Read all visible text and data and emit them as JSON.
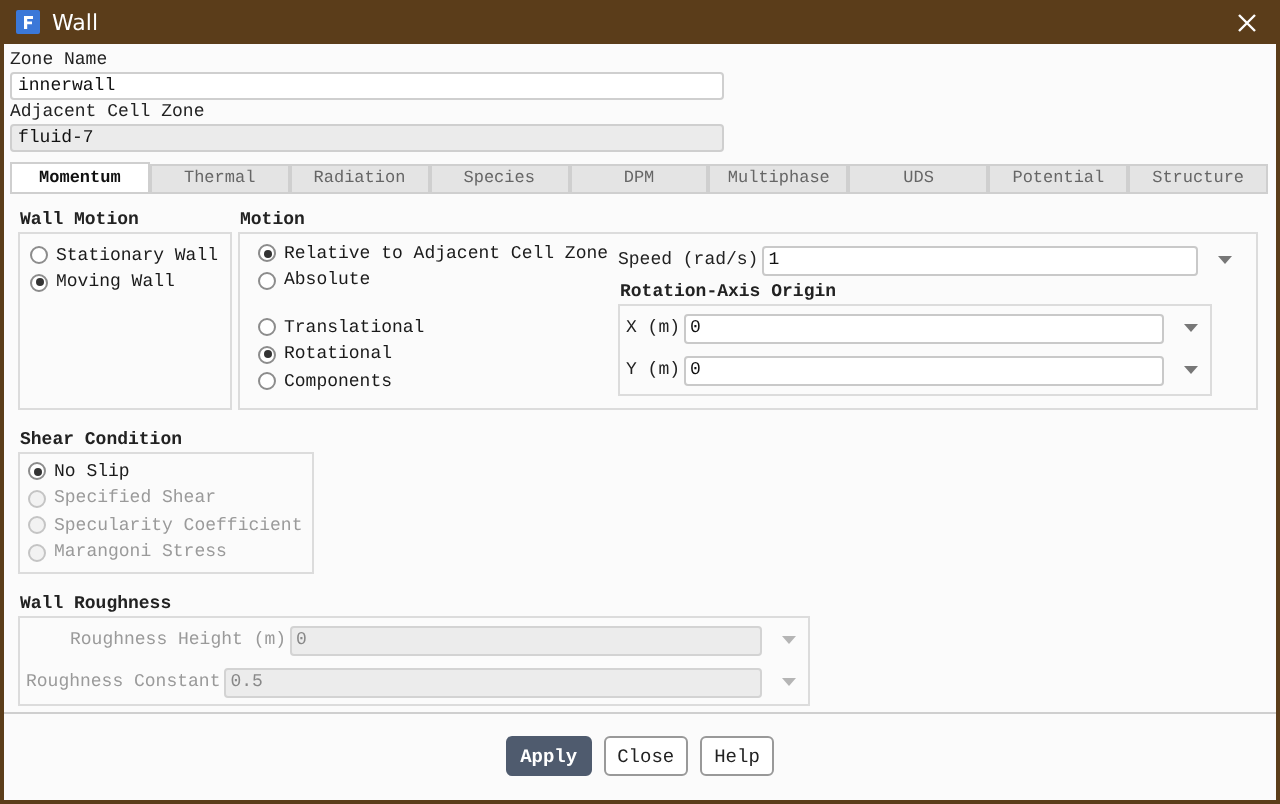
{
  "window": {
    "title": "Wall"
  },
  "zone_name": {
    "label": "Zone Name",
    "value": "innerwall",
    "disabled": false
  },
  "adjacent_cell_zone": {
    "label": "Adjacent Cell Zone",
    "value": "fluid-7",
    "disabled": true
  },
  "tabs": [
    {
      "label": "Momentum",
      "selected": true
    },
    {
      "label": "Thermal",
      "selected": false
    },
    {
      "label": "Radiation",
      "selected": false
    },
    {
      "label": "Species",
      "selected": false
    },
    {
      "label": "DPM",
      "selected": false
    },
    {
      "label": "Multiphase",
      "selected": false
    },
    {
      "label": "UDS",
      "selected": false
    },
    {
      "label": "Potential",
      "selected": false
    },
    {
      "label": "Structure",
      "selected": false
    }
  ],
  "wall_motion": {
    "title": "Wall Motion",
    "options": [
      {
        "label": "Stationary Wall",
        "selected": false,
        "disabled": false
      },
      {
        "label": "Moving Wall",
        "selected": true,
        "disabled": false
      }
    ]
  },
  "motion": {
    "title": "Motion",
    "reference": [
      {
        "label": "Relative to Adjacent Cell Zone",
        "selected": true,
        "disabled": false
      },
      {
        "label": "Absolute",
        "selected": false,
        "disabled": false
      }
    ],
    "type": [
      {
        "label": "Translational",
        "selected": false,
        "disabled": false
      },
      {
        "label": "Rotational",
        "selected": true,
        "disabled": false
      },
      {
        "label": "Components",
        "selected": false,
        "disabled": false
      }
    ],
    "speed": {
      "label": "Speed (rad/s)",
      "value": "1",
      "disabled": false,
      "dropdown": true
    },
    "rotation_axis_origin": {
      "title": "Rotation-Axis Origin",
      "fields": [
        {
          "label": "X (m)",
          "value": "0",
          "disabled": false,
          "dropdown": true
        },
        {
          "label": "Y (m)",
          "value": "0",
          "disabled": false,
          "dropdown": true
        }
      ]
    }
  },
  "shear_condition": {
    "title": "Shear Condition",
    "options": [
      {
        "label": "No Slip",
        "selected": true,
        "disabled": false
      },
      {
        "label": "Specified Shear",
        "selected": false,
        "disabled": true
      },
      {
        "label": "Specularity Coefficient",
        "selected": false,
        "disabled": true
      },
      {
        "label": "Marangoni Stress",
        "selected": false,
        "disabled": true
      }
    ]
  },
  "wall_roughness": {
    "title": "Wall Roughness",
    "fields": [
      {
        "label": "Roughness Height (m)",
        "value": "0",
        "disabled": true,
        "dropdown": true
      },
      {
        "label": "Roughness Constant",
        "value": "0.5",
        "disabled": true,
        "dropdown": true
      }
    ]
  },
  "buttons": [
    {
      "label": "Apply",
      "kind": "primary"
    },
    {
      "label": "Close",
      "kind": "default"
    },
    {
      "label": "Help",
      "kind": "default"
    }
  ]
}
